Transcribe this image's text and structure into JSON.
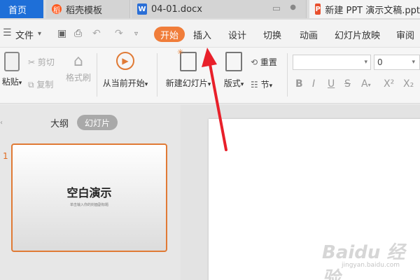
{
  "tabs": {
    "home": "首页",
    "template": "稻壳模板",
    "docx": "04-01.docx",
    "ppt": "新建 PPT 演示文稿.ppt"
  },
  "menubar": {
    "file": "文件",
    "start": "开始",
    "insert": "插入",
    "design": "设计",
    "transition": "切换",
    "animation": "动画",
    "slideshow": "幻灯片放映",
    "review": "审阅"
  },
  "toolbar": {
    "paste": "粘贴",
    "cut": "剪切",
    "copy": "复制",
    "format_painter": "格式刷",
    "play_from_current": "从当前开始",
    "new_slide": "新建幻灯片",
    "layout": "版式",
    "reset": "重置",
    "section": "节",
    "font_size_value": "0"
  },
  "panel": {
    "outline": "大纲",
    "slides": "幻灯片",
    "slide_number": "1",
    "thumb_title": "空白演示",
    "thumb_subtitle": "单击输入你的封面副标题"
  },
  "watermark": {
    "brand": "Baidu 经验",
    "url": "jingyan.baidu.com"
  },
  "colors": {
    "accent": "#f07d3a",
    "home_tab": "#1e6fd8",
    "arrow": "#e8202a"
  }
}
